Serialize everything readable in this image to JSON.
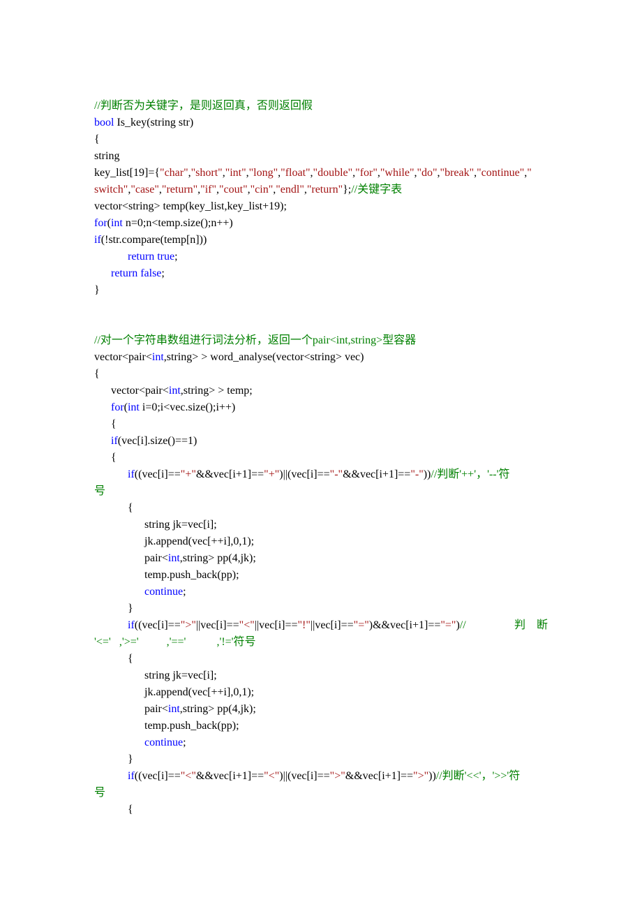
{
  "lines": [
    {
      "segments": [
        {
          "cls": "green",
          "t": "//判断否为关键字，是则返回真，否则返回假"
        }
      ]
    },
    {
      "segments": [
        {
          "cls": "blue",
          "t": "bool"
        },
        {
          "cls": "black",
          "t": " Is_key(string str)"
        }
      ]
    },
    {
      "segments": [
        {
          "cls": "black",
          "t": "{"
        }
      ]
    },
    {
      "segments": [
        {
          "cls": "black",
          "t": "string"
        }
      ]
    },
    {
      "segments": [
        {
          "cls": "black",
          "t": "key_list[19]={"
        },
        {
          "cls": "red",
          "t": "\"char\""
        },
        {
          "cls": "black",
          "t": ","
        },
        {
          "cls": "red",
          "t": "\"short\""
        },
        {
          "cls": "black",
          "t": ","
        },
        {
          "cls": "red",
          "t": "\"int\""
        },
        {
          "cls": "black",
          "t": ","
        },
        {
          "cls": "red",
          "t": "\"long\""
        },
        {
          "cls": "black",
          "t": ","
        },
        {
          "cls": "red",
          "t": "\"float\""
        },
        {
          "cls": "black",
          "t": ","
        },
        {
          "cls": "red",
          "t": "\"double\""
        },
        {
          "cls": "black",
          "t": ","
        },
        {
          "cls": "red",
          "t": "\"for\""
        },
        {
          "cls": "black",
          "t": ","
        },
        {
          "cls": "red",
          "t": "\"while\""
        },
        {
          "cls": "black",
          "t": ","
        },
        {
          "cls": "red",
          "t": "\"do\""
        },
        {
          "cls": "black",
          "t": ","
        },
        {
          "cls": "red",
          "t": "\"break\""
        },
        {
          "cls": "black",
          "t": ","
        },
        {
          "cls": "red",
          "t": "\"continue\""
        },
        {
          "cls": "black",
          "t": ","
        },
        {
          "cls": "red",
          "t": "\""
        }
      ]
    },
    {
      "segments": [
        {
          "cls": "red",
          "t": "switch\""
        },
        {
          "cls": "black",
          "t": ","
        },
        {
          "cls": "red",
          "t": "\"case\""
        },
        {
          "cls": "black",
          "t": ","
        },
        {
          "cls": "red",
          "t": "\"return\""
        },
        {
          "cls": "black",
          "t": ","
        },
        {
          "cls": "red",
          "t": "\"if\""
        },
        {
          "cls": "black",
          "t": ","
        },
        {
          "cls": "red",
          "t": "\"cout\""
        },
        {
          "cls": "black",
          "t": ","
        },
        {
          "cls": "red",
          "t": "\"cin\""
        },
        {
          "cls": "black",
          "t": ","
        },
        {
          "cls": "red",
          "t": "\"endl\""
        },
        {
          "cls": "black",
          "t": ","
        },
        {
          "cls": "red",
          "t": "\"return\""
        },
        {
          "cls": "black",
          "t": "};"
        },
        {
          "cls": "green",
          "t": "//关键字表"
        }
      ]
    },
    {
      "segments": [
        {
          "cls": "black",
          "t": "vector<string> temp(key_list,key_list+19);"
        }
      ]
    },
    {
      "segments": [
        {
          "cls": "blue",
          "t": "for"
        },
        {
          "cls": "black",
          "t": "("
        },
        {
          "cls": "blue",
          "t": "int"
        },
        {
          "cls": "black",
          "t": " n=0;n<temp.size();n++)"
        }
      ]
    },
    {
      "segments": [
        {
          "cls": "blue",
          "t": "if"
        },
        {
          "cls": "black",
          "t": "(!str.compare(temp[n]))"
        }
      ]
    },
    {
      "segments": [
        {
          "cls": "black",
          "t": "            "
        },
        {
          "cls": "blue",
          "t": "return"
        },
        {
          "cls": "black",
          "t": " "
        },
        {
          "cls": "blue",
          "t": "true"
        },
        {
          "cls": "black",
          "t": ";"
        }
      ]
    },
    {
      "segments": [
        {
          "cls": "black",
          "t": "      "
        },
        {
          "cls": "blue",
          "t": "return"
        },
        {
          "cls": "black",
          "t": " "
        },
        {
          "cls": "blue",
          "t": "false"
        },
        {
          "cls": "black",
          "t": ";"
        }
      ]
    },
    {
      "segments": [
        {
          "cls": "black",
          "t": "}"
        }
      ]
    },
    {
      "segments": [
        {
          "cls": "black",
          "t": " "
        }
      ]
    },
    {
      "segments": [
        {
          "cls": "black",
          "t": " "
        }
      ]
    },
    {
      "segments": [
        {
          "cls": "green",
          "t": "//对一个字符串数组进行词法分析，返回一个pair<int,string>型容器"
        }
      ]
    },
    {
      "segments": [
        {
          "cls": "black",
          "t": "vector<pair<"
        },
        {
          "cls": "blue",
          "t": "int"
        },
        {
          "cls": "black",
          "t": ",string> > word_analyse(vector<string> vec)"
        }
      ]
    },
    {
      "segments": [
        {
          "cls": "black",
          "t": "{"
        }
      ]
    },
    {
      "segments": [
        {
          "cls": "black",
          "t": "      vector<pair<"
        },
        {
          "cls": "blue",
          "t": "int"
        },
        {
          "cls": "black",
          "t": ",string> > temp;"
        }
      ]
    },
    {
      "segments": [
        {
          "cls": "black",
          "t": "      "
        },
        {
          "cls": "blue",
          "t": "for"
        },
        {
          "cls": "black",
          "t": "("
        },
        {
          "cls": "blue",
          "t": "int"
        },
        {
          "cls": "black",
          "t": " i=0;i<vec.size();i++)"
        }
      ]
    },
    {
      "segments": [
        {
          "cls": "black",
          "t": "      {"
        }
      ]
    },
    {
      "segments": [
        {
          "cls": "black",
          "t": "      "
        },
        {
          "cls": "blue",
          "t": "if"
        },
        {
          "cls": "black",
          "t": "(vec[i].size()==1)"
        }
      ]
    },
    {
      "segments": [
        {
          "cls": "black",
          "t": "      {"
        }
      ]
    },
    {
      "segments": [
        {
          "cls": "black",
          "t": "            "
        },
        {
          "cls": "blue",
          "t": "if"
        },
        {
          "cls": "black",
          "t": "((vec[i]=="
        },
        {
          "cls": "red",
          "t": "\"+\""
        },
        {
          "cls": "black",
          "t": "&&vec[i+1]=="
        },
        {
          "cls": "red",
          "t": "\"+\""
        },
        {
          "cls": "black",
          "t": ")||(vec[i]=="
        },
        {
          "cls": "red",
          "t": "\"-\""
        },
        {
          "cls": "black",
          "t": "&&vec[i+1]=="
        },
        {
          "cls": "red",
          "t": "\"-\""
        },
        {
          "cls": "black",
          "t": "))"
        },
        {
          "cls": "green",
          "t": "//判断'++'，'--'符"
        }
      ]
    },
    {
      "segments": [
        {
          "cls": "green",
          "t": "号"
        }
      ]
    },
    {
      "segments": [
        {
          "cls": "black",
          "t": "            {"
        }
      ]
    },
    {
      "segments": [
        {
          "cls": "black",
          "t": "                  string jk=vec[i];"
        }
      ]
    },
    {
      "segments": [
        {
          "cls": "black",
          "t": "                  jk.append(vec[++i],0,1);"
        }
      ]
    },
    {
      "segments": [
        {
          "cls": "black",
          "t": "                  pair<"
        },
        {
          "cls": "blue",
          "t": "int"
        },
        {
          "cls": "black",
          "t": ",string> pp(4,jk);"
        }
      ]
    },
    {
      "segments": [
        {
          "cls": "black",
          "t": "                  temp.push_back(pp);"
        }
      ]
    },
    {
      "segments": [
        {
          "cls": "black",
          "t": "                  "
        },
        {
          "cls": "blue",
          "t": "continue"
        },
        {
          "cls": "black",
          "t": ";"
        }
      ]
    },
    {
      "segments": [
        {
          "cls": "black",
          "t": "            }"
        }
      ]
    },
    {
      "justify": true,
      "segments": [
        {
          "cls": "black",
          "t": "            "
        },
        {
          "cls": "blue",
          "t": "if"
        },
        {
          "cls": "black",
          "t": "((vec[i]=="
        },
        {
          "cls": "red",
          "t": "\">\""
        },
        {
          "cls": "black",
          "t": "||vec[i]=="
        },
        {
          "cls": "red",
          "t": "\"<\""
        },
        {
          "cls": "black",
          "t": "||vec[i]=="
        },
        {
          "cls": "red",
          "t": "\"!\""
        },
        {
          "cls": "black",
          "t": "||vec[i]=="
        },
        {
          "cls": "red",
          "t": "\"=\""
        },
        {
          "cls": "black",
          "t": ")&&vec[i+1]=="
        },
        {
          "cls": "red",
          "t": "\"=\""
        },
        {
          "cls": "black",
          "t": ")"
        },
        {
          "cls": "green",
          "t": "//"
        }
      ],
      "right": [
        {
          "cls": "green",
          "t": "判"
        },
        {
          "cls": "green",
          "t": "    断"
        }
      ]
    },
    {
      "segments": [
        {
          "cls": "green",
          "t": "'<='   ,'>='          ,'=='           ,'!='符号"
        }
      ]
    },
    {
      "segments": [
        {
          "cls": "black",
          "t": "            {"
        }
      ]
    },
    {
      "segments": [
        {
          "cls": "black",
          "t": "                  string jk=vec[i];"
        }
      ]
    },
    {
      "segments": [
        {
          "cls": "black",
          "t": "                  jk.append(vec[++i],0,1);"
        }
      ]
    },
    {
      "segments": [
        {
          "cls": "black",
          "t": "                  pair<"
        },
        {
          "cls": "blue",
          "t": "int"
        },
        {
          "cls": "black",
          "t": ",string> pp(4,jk);"
        }
      ]
    },
    {
      "segments": [
        {
          "cls": "black",
          "t": "                  temp.push_back(pp);"
        }
      ]
    },
    {
      "segments": [
        {
          "cls": "black",
          "t": "                  "
        },
        {
          "cls": "blue",
          "t": "continue"
        },
        {
          "cls": "black",
          "t": ";"
        }
      ]
    },
    {
      "segments": [
        {
          "cls": "black",
          "t": "            }"
        }
      ]
    },
    {
      "segments": [
        {
          "cls": "black",
          "t": "            "
        },
        {
          "cls": "blue",
          "t": "if"
        },
        {
          "cls": "black",
          "t": "((vec[i]=="
        },
        {
          "cls": "red",
          "t": "\"<\""
        },
        {
          "cls": "black",
          "t": "&&vec[i+1]=="
        },
        {
          "cls": "red",
          "t": "\"<\""
        },
        {
          "cls": "black",
          "t": ")||(vec[i]=="
        },
        {
          "cls": "red",
          "t": "\">\""
        },
        {
          "cls": "black",
          "t": "&&vec[i+1]=="
        },
        {
          "cls": "red",
          "t": "\">\""
        },
        {
          "cls": "black",
          "t": "))"
        },
        {
          "cls": "green",
          "t": "//判断'<<'，'>>'符"
        }
      ]
    },
    {
      "segments": [
        {
          "cls": "green",
          "t": "号"
        }
      ]
    },
    {
      "segments": [
        {
          "cls": "black",
          "t": "            {"
        }
      ]
    }
  ]
}
